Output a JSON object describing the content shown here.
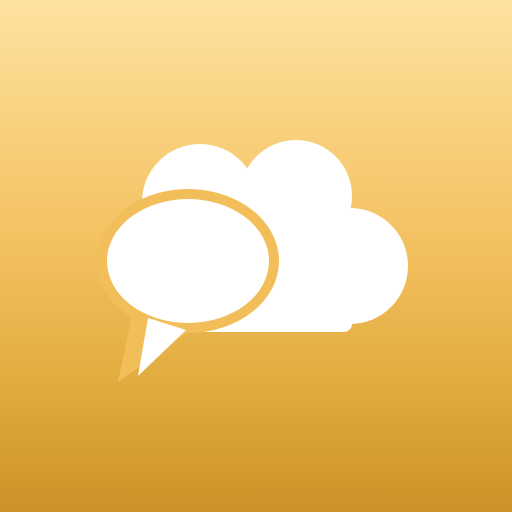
{
  "app_icon": {
    "icon_name": "cloud-chat-bubble-icon",
    "colors": {
      "background_top": "#FEE2A0",
      "background_mid": "#F4C363",
      "background_bottom": "#CC9128",
      "glyph": "#FFFFFF"
    }
  }
}
